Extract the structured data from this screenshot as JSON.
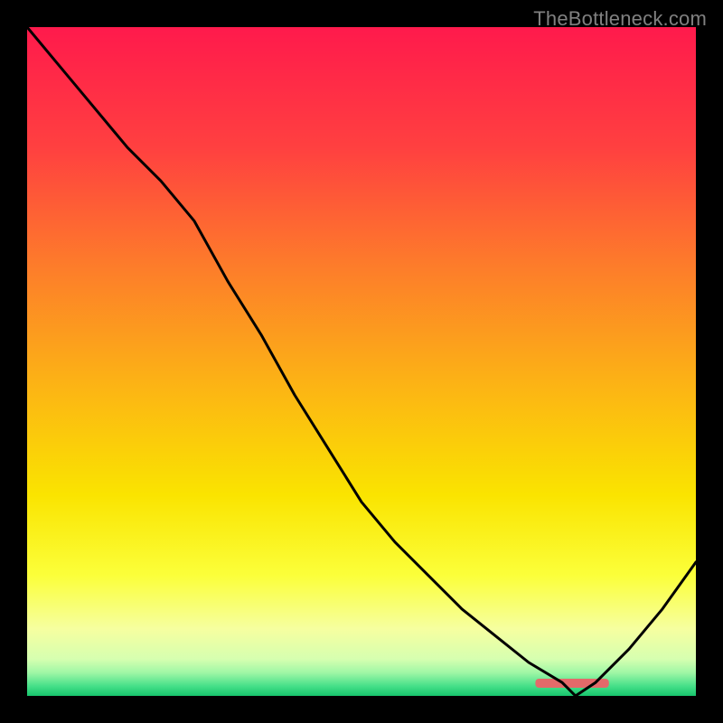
{
  "watermark": "TheBottleneck.com",
  "chart_data": {
    "type": "line",
    "title": "",
    "xlabel": "",
    "ylabel": "",
    "x": [
      0.0,
      0.05,
      0.1,
      0.15,
      0.2,
      0.25,
      0.3,
      0.35,
      0.4,
      0.45,
      0.5,
      0.55,
      0.6,
      0.65,
      0.7,
      0.75,
      0.8,
      0.82,
      0.85,
      0.9,
      0.95,
      1.0
    ],
    "values": [
      1.0,
      0.94,
      0.88,
      0.82,
      0.77,
      0.71,
      0.62,
      0.54,
      0.45,
      0.37,
      0.29,
      0.23,
      0.18,
      0.13,
      0.09,
      0.05,
      0.02,
      0.0,
      0.02,
      0.07,
      0.13,
      0.2
    ],
    "xlim": [
      0,
      1
    ],
    "ylim": [
      0,
      1
    ],
    "highlight_band": {
      "x0": 0.76,
      "x1": 0.87,
      "color": "#e46a6a"
    },
    "gradient_stops": [
      {
        "offset": 0.0,
        "color": "#ff1a4c"
      },
      {
        "offset": 0.18,
        "color": "#ff4040"
      },
      {
        "offset": 0.36,
        "color": "#fd7d2a"
      },
      {
        "offset": 0.54,
        "color": "#fcb514"
      },
      {
        "offset": 0.7,
        "color": "#fae400"
      },
      {
        "offset": 0.82,
        "color": "#fbff3a"
      },
      {
        "offset": 0.9,
        "color": "#f6ffa0"
      },
      {
        "offset": 0.945,
        "color": "#d6ffb0"
      },
      {
        "offset": 0.965,
        "color": "#a0f7a6"
      },
      {
        "offset": 0.985,
        "color": "#47e089"
      },
      {
        "offset": 1.0,
        "color": "#17c56d"
      }
    ]
  }
}
